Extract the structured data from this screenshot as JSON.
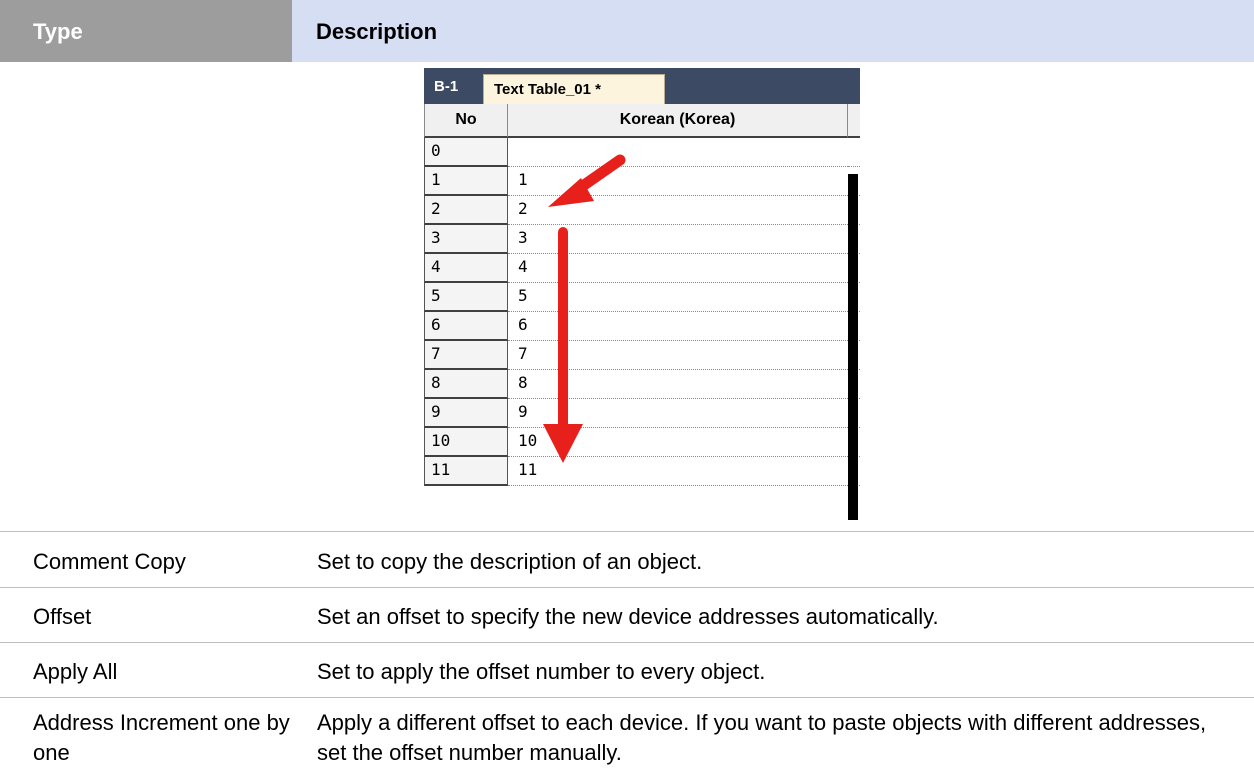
{
  "header": {
    "type": "Type",
    "description": "Description"
  },
  "screenshot": {
    "tabs": [
      "B-1",
      "Text Table_01 *"
    ],
    "columns": [
      "No",
      "Korean (Korea)"
    ],
    "rows": [
      {
        "no": "0",
        "value": ""
      },
      {
        "no": "1",
        "value": "1"
      },
      {
        "no": "2",
        "value": "2"
      },
      {
        "no": "3",
        "value": "3"
      },
      {
        "no": "4",
        "value": "4"
      },
      {
        "no": "5",
        "value": "5"
      },
      {
        "no": "6",
        "value": "6"
      },
      {
        "no": "7",
        "value": "7"
      },
      {
        "no": "8",
        "value": "8"
      },
      {
        "no": "9",
        "value": "9"
      },
      {
        "no": "10",
        "value": "10"
      },
      {
        "no": "11",
        "value": "11"
      }
    ]
  },
  "table": [
    {
      "type": "Comment Copy",
      "description": "Set to copy the description of an object."
    },
    {
      "type": "Offset",
      "description": "Set an offset to specify the new device addresses automatically."
    },
    {
      "type": "Apply All",
      "description": "Set to apply the offset number to every object."
    },
    {
      "type": "Address Increment one by one",
      "description": "Apply a different offset to each device. If you want to paste objects with different addresses, set the offset number manually."
    }
  ],
  "colors": {
    "header_type_bg": "#9d9d9d",
    "header_desc_bg": "#d6def4",
    "arrow": "#e8201c"
  }
}
